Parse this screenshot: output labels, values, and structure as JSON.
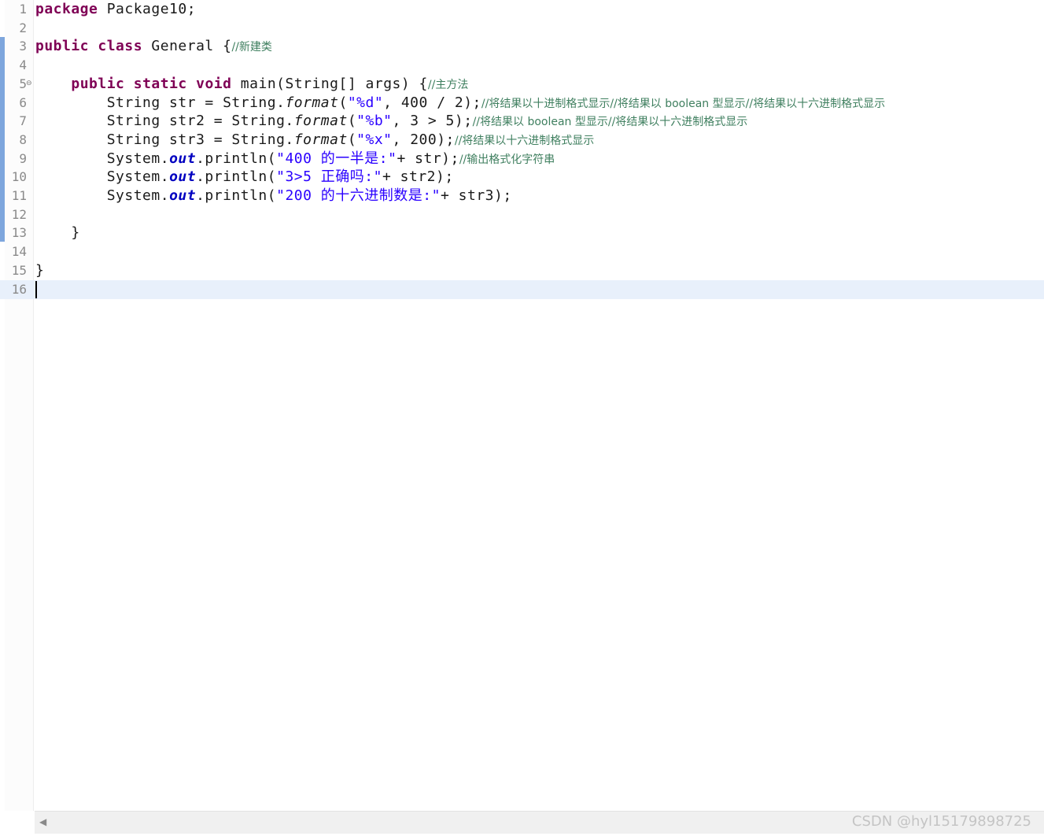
{
  "editor": {
    "lines": [
      {
        "num": "1",
        "tokens": [
          {
            "t": "package",
            "c": "kw"
          },
          {
            "t": " Package10;",
            "c": "ident"
          }
        ]
      },
      {
        "num": "2",
        "tokens": []
      },
      {
        "num": "3",
        "tokens": [
          {
            "t": "public",
            "c": "kw"
          },
          {
            "t": " ",
            "c": "ident"
          },
          {
            "t": "class",
            "c": "kw"
          },
          {
            "t": " General {",
            "c": "ident"
          },
          {
            "t": "//新建类",
            "c": "comment"
          }
        ]
      },
      {
        "num": "4",
        "tokens": []
      },
      {
        "num": "5",
        "fold": "⊖",
        "tokens": [
          {
            "t": "    ",
            "c": "ident"
          },
          {
            "t": "public",
            "c": "kw"
          },
          {
            "t": " ",
            "c": "ident"
          },
          {
            "t": "static",
            "c": "kw"
          },
          {
            "t": " ",
            "c": "ident"
          },
          {
            "t": "void",
            "c": "kw"
          },
          {
            "t": " main(String[] args) {",
            "c": "ident"
          },
          {
            "t": "//主方法",
            "c": "comment"
          }
        ]
      },
      {
        "num": "6",
        "tokens": [
          {
            "t": "        String str = String.",
            "c": "ident"
          },
          {
            "t": "format",
            "c": "static-method"
          },
          {
            "t": "(",
            "c": "ident"
          },
          {
            "t": "\"%d\"",
            "c": "str"
          },
          {
            "t": ", 400 / 2);",
            "c": "ident"
          },
          {
            "t": "//将结果以十进制格式显示//将结果以 boolean 型显示//将结果以十六进制格式显示",
            "c": "comment"
          }
        ]
      },
      {
        "num": "7",
        "tokens": [
          {
            "t": "        String str2 = String.",
            "c": "ident"
          },
          {
            "t": "format",
            "c": "static-method"
          },
          {
            "t": "(",
            "c": "ident"
          },
          {
            "t": "\"%b\"",
            "c": "str"
          },
          {
            "t": ", 3 > 5);",
            "c": "ident"
          },
          {
            "t": "//将结果以 boolean 型显示//将结果以十六进制格式显示",
            "c": "comment"
          }
        ]
      },
      {
        "num": "8",
        "tokens": [
          {
            "t": "        String str3 = String.",
            "c": "ident"
          },
          {
            "t": "format",
            "c": "static-method"
          },
          {
            "t": "(",
            "c": "ident"
          },
          {
            "t": "\"%x\"",
            "c": "str"
          },
          {
            "t": ", 200);",
            "c": "ident"
          },
          {
            "t": "//将结果以十六进制格式显示",
            "c": "comment"
          }
        ]
      },
      {
        "num": "9",
        "tokens": [
          {
            "t": "        System.",
            "c": "ident"
          },
          {
            "t": "out",
            "c": "static-field"
          },
          {
            "t": ".println(",
            "c": "ident"
          },
          {
            "t": "\"400 的一半是:\"",
            "c": "str"
          },
          {
            "t": "+ str);",
            "c": "ident"
          },
          {
            "t": "//输出格式化字符串",
            "c": "comment"
          }
        ]
      },
      {
        "num": "10",
        "tokens": [
          {
            "t": "        System.",
            "c": "ident"
          },
          {
            "t": "out",
            "c": "static-field"
          },
          {
            "t": ".println(",
            "c": "ident"
          },
          {
            "t": "\"3>5 正确吗:\"",
            "c": "str"
          },
          {
            "t": "+ str2);",
            "c": "ident"
          }
        ]
      },
      {
        "num": "11",
        "tokens": [
          {
            "t": "        System.",
            "c": "ident"
          },
          {
            "t": "out",
            "c": "static-field"
          },
          {
            "t": ".println(",
            "c": "ident"
          },
          {
            "t": "\"200 的十六进制数是:\"",
            "c": "str"
          },
          {
            "t": "+ str3);",
            "c": "ident"
          }
        ]
      },
      {
        "num": "12",
        "tokens": []
      },
      {
        "num": "13",
        "tokens": [
          {
            "t": "    }",
            "c": "ident"
          }
        ]
      },
      {
        "num": "14",
        "tokens": []
      },
      {
        "num": "15",
        "tokens": [
          {
            "t": "}",
            "c": "ident"
          }
        ]
      },
      {
        "num": "16",
        "current": true,
        "tokens": []
      }
    ]
  },
  "scrollbar": {
    "left_arrow": "◀"
  },
  "watermark": "CSDN @hyl15179898725"
}
